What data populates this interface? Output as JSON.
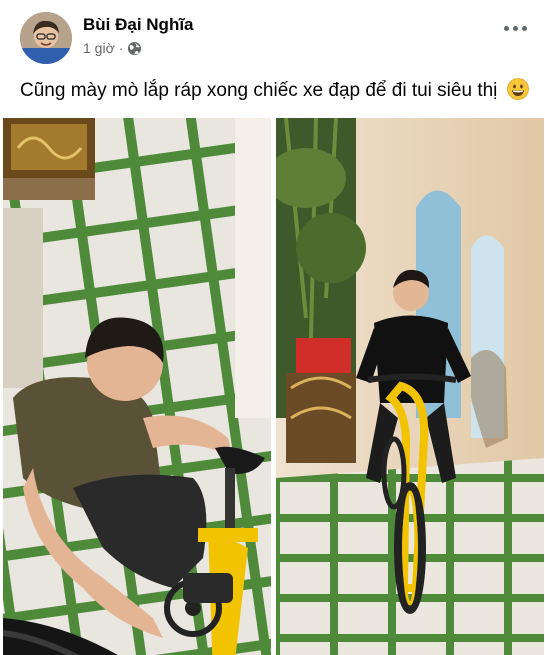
{
  "post": {
    "author_name": "Bùi Đại Nghĩa",
    "timestamp": "1 giờ",
    "separator": "·",
    "privacy_icon": "globe-icon",
    "more_icon": "more-options-icon",
    "caption": "Cũng mày mò lắp ráp xong chiếc xe đạp để đi tui siêu thị",
    "caption_emoji": "grinning-face-emoji"
  },
  "photos": [
    {
      "name": "photo-man-assembling-bicycle"
    },
    {
      "name": "photo-man-riding-yellow-bicycle"
    }
  ],
  "colors": {
    "meta_gray": "#65676b",
    "bike_yellow": "#f2c300",
    "tile_green": "#4e8a3a"
  }
}
